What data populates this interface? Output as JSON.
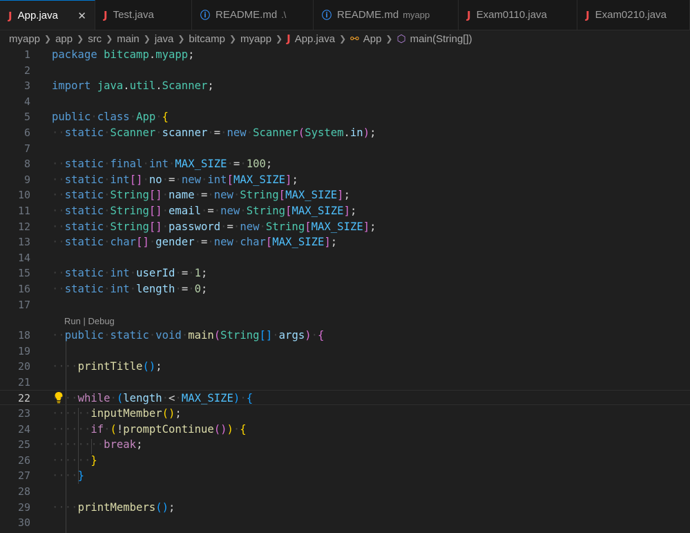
{
  "tabs": [
    {
      "label": "App.java",
      "icon": "java-icon",
      "active": true,
      "close": "✕"
    },
    {
      "label": "Test.java",
      "icon": "java-icon"
    },
    {
      "label": "README.md",
      "icon": "info-icon",
      "desc": ".\\"
    },
    {
      "label": "README.md",
      "icon": "info-icon",
      "desc": "myapp"
    },
    {
      "label": "Exam0110.java",
      "icon": "java-icon"
    },
    {
      "label": "Exam0210.java",
      "icon": "java-icon"
    }
  ],
  "breadcrumb": [
    "myapp",
    "app",
    "src",
    "main",
    "java",
    "bitcamp",
    "myapp",
    "App.java",
    "App",
    "main(String[])"
  ],
  "codelens": {
    "run": "Run",
    "separator": " | ",
    "debug": "Debug"
  },
  "current_line": 22,
  "colors": {
    "accent": "#0078d4",
    "java_icon": "#f14c4c",
    "info_icon": "#3794ff",
    "background": "#1f1f1f"
  },
  "lines": [
    {
      "n": "1",
      "tokens": [
        [
          "kw",
          "package"
        ],
        [
          "pn",
          " "
        ],
        [
          "ty",
          "bitcamp"
        ],
        [
          "pn",
          "."
        ],
        [
          "ty",
          "myapp"
        ],
        [
          "pn",
          ";"
        ]
      ]
    },
    {
      "n": "2",
      "tokens": []
    },
    {
      "n": "3",
      "tokens": [
        [
          "kw",
          "import"
        ],
        [
          "pn",
          " "
        ],
        [
          "ty",
          "java"
        ],
        [
          "pn",
          "."
        ],
        [
          "ty",
          "util"
        ],
        [
          "pn",
          "."
        ],
        [
          "ty",
          "Scanner"
        ],
        [
          "pn",
          ";"
        ]
      ]
    },
    {
      "n": "4",
      "tokens": []
    },
    {
      "n": "5",
      "tokens": [
        [
          "kw",
          "public"
        ],
        [
          "ws",
          "·"
        ],
        [
          "kw",
          "class"
        ],
        [
          "ws",
          "·"
        ],
        [
          "ty",
          "App"
        ],
        [
          "ws",
          "·"
        ],
        [
          "b1",
          "{"
        ]
      ]
    },
    {
      "n": "6",
      "tokens": [
        [
          "ws",
          "··"
        ],
        [
          "kw",
          "static"
        ],
        [
          "ws",
          "·"
        ],
        [
          "ty",
          "Scanner"
        ],
        [
          "ws",
          "·"
        ],
        [
          "va",
          "scanner"
        ],
        [
          "ws",
          "·"
        ],
        [
          "pn",
          "="
        ],
        [
          "ws",
          "·"
        ],
        [
          "kw",
          "new"
        ],
        [
          "ws",
          "·"
        ],
        [
          "ty",
          "Scanner"
        ],
        [
          "b2",
          "("
        ],
        [
          "ty",
          "System"
        ],
        [
          "pn",
          "."
        ],
        [
          "va",
          "in"
        ],
        [
          "b2",
          ")"
        ],
        [
          "pn",
          ";"
        ]
      ]
    },
    {
      "n": "7",
      "tokens": []
    },
    {
      "n": "8",
      "tokens": [
        [
          "ws",
          "··"
        ],
        [
          "kw",
          "static"
        ],
        [
          "ws",
          "·"
        ],
        [
          "kw",
          "final"
        ],
        [
          "ws",
          "·"
        ],
        [
          "kw",
          "int"
        ],
        [
          "ws",
          "·"
        ],
        [
          "co",
          "MAX_SIZE"
        ],
        [
          "ws",
          "·"
        ],
        [
          "pn",
          "="
        ],
        [
          "ws",
          "·"
        ],
        [
          "nu",
          "100"
        ],
        [
          "pn",
          ";"
        ]
      ]
    },
    {
      "n": "9",
      "tokens": [
        [
          "ws",
          "··"
        ],
        [
          "kw",
          "static"
        ],
        [
          "ws",
          "·"
        ],
        [
          "kw",
          "int"
        ],
        [
          "b2",
          "[]"
        ],
        [
          "ws",
          "·"
        ],
        [
          "va",
          "no"
        ],
        [
          "ws",
          "·"
        ],
        [
          "pn",
          "="
        ],
        [
          "ws",
          "·"
        ],
        [
          "kw",
          "new"
        ],
        [
          "ws",
          "·"
        ],
        [
          "kw",
          "int"
        ],
        [
          "b2",
          "["
        ],
        [
          "co",
          "MAX_SIZE"
        ],
        [
          "b2",
          "]"
        ],
        [
          "pn",
          ";"
        ]
      ]
    },
    {
      "n": "10",
      "tokens": [
        [
          "ws",
          "··"
        ],
        [
          "kw",
          "static"
        ],
        [
          "ws",
          "·"
        ],
        [
          "ty",
          "String"
        ],
        [
          "b2",
          "[]"
        ],
        [
          "ws",
          "·"
        ],
        [
          "va",
          "name"
        ],
        [
          "ws",
          "·"
        ],
        [
          "pn",
          "="
        ],
        [
          "ws",
          "·"
        ],
        [
          "kw",
          "new"
        ],
        [
          "ws",
          "·"
        ],
        [
          "ty",
          "String"
        ],
        [
          "b2",
          "["
        ],
        [
          "co",
          "MAX_SIZE"
        ],
        [
          "b2",
          "]"
        ],
        [
          "pn",
          ";"
        ]
      ]
    },
    {
      "n": "11",
      "tokens": [
        [
          "ws",
          "··"
        ],
        [
          "kw",
          "static"
        ],
        [
          "ws",
          "·"
        ],
        [
          "ty",
          "String"
        ],
        [
          "b2",
          "[]"
        ],
        [
          "ws",
          "·"
        ],
        [
          "va",
          "email"
        ],
        [
          "ws",
          "·"
        ],
        [
          "pn",
          "="
        ],
        [
          "ws",
          "·"
        ],
        [
          "kw",
          "new"
        ],
        [
          "ws",
          "·"
        ],
        [
          "ty",
          "String"
        ],
        [
          "b2",
          "["
        ],
        [
          "co",
          "MAX_SIZE"
        ],
        [
          "b2",
          "]"
        ],
        [
          "pn",
          ";"
        ]
      ]
    },
    {
      "n": "12",
      "tokens": [
        [
          "ws",
          "··"
        ],
        [
          "kw",
          "static"
        ],
        [
          "ws",
          "·"
        ],
        [
          "ty",
          "String"
        ],
        [
          "b2",
          "[]"
        ],
        [
          "ws",
          "·"
        ],
        [
          "va",
          "password"
        ],
        [
          "ws",
          "·"
        ],
        [
          "pn",
          "="
        ],
        [
          "ws",
          "·"
        ],
        [
          "kw",
          "new"
        ],
        [
          "ws",
          "·"
        ],
        [
          "ty",
          "String"
        ],
        [
          "b2",
          "["
        ],
        [
          "co",
          "MAX_SIZE"
        ],
        [
          "b2",
          "]"
        ],
        [
          "pn",
          ";"
        ]
      ]
    },
    {
      "n": "13",
      "tokens": [
        [
          "ws",
          "··"
        ],
        [
          "kw",
          "static"
        ],
        [
          "ws",
          "·"
        ],
        [
          "kw",
          "char"
        ],
        [
          "b2",
          "[]"
        ],
        [
          "ws",
          "·"
        ],
        [
          "va",
          "gender"
        ],
        [
          "ws",
          "·"
        ],
        [
          "pn",
          "="
        ],
        [
          "ws",
          "·"
        ],
        [
          "kw",
          "new"
        ],
        [
          "ws",
          "·"
        ],
        [
          "kw",
          "char"
        ],
        [
          "b2",
          "["
        ],
        [
          "co",
          "MAX_SIZE"
        ],
        [
          "b2",
          "]"
        ],
        [
          "pn",
          ";"
        ]
      ]
    },
    {
      "n": "14",
      "tokens": []
    },
    {
      "n": "15",
      "tokens": [
        [
          "ws",
          "··"
        ],
        [
          "kw",
          "static"
        ],
        [
          "ws",
          "·"
        ],
        [
          "kw",
          "int"
        ],
        [
          "ws",
          "·"
        ],
        [
          "va",
          "userId"
        ],
        [
          "ws",
          "·"
        ],
        [
          "pn",
          "="
        ],
        [
          "ws",
          "·"
        ],
        [
          "nu",
          "1"
        ],
        [
          "pn",
          ";"
        ]
      ]
    },
    {
      "n": "16",
      "tokens": [
        [
          "ws",
          "··"
        ],
        [
          "kw",
          "static"
        ],
        [
          "ws",
          "·"
        ],
        [
          "kw",
          "int"
        ],
        [
          "ws",
          "·"
        ],
        [
          "va",
          "length"
        ],
        [
          "ws",
          "·"
        ],
        [
          "pn",
          "="
        ],
        [
          "ws",
          "·"
        ],
        [
          "nu",
          "0"
        ],
        [
          "pn",
          ";"
        ]
      ]
    },
    {
      "n": "17",
      "tokens": []
    },
    {
      "n": "18",
      "tokens": [
        [
          "ws",
          "··"
        ],
        [
          "kw",
          "public"
        ],
        [
          "ws",
          "·"
        ],
        [
          "kw",
          "static"
        ],
        [
          "ws",
          "·"
        ],
        [
          "kw",
          "void"
        ],
        [
          "ws",
          "·"
        ],
        [
          "fn",
          "main"
        ],
        [
          "b2",
          "("
        ],
        [
          "ty",
          "String"
        ],
        [
          "b3",
          "[]"
        ],
        [
          "ws",
          "·"
        ],
        [
          "va",
          "args"
        ],
        [
          "b2",
          ")"
        ],
        [
          "ws",
          "·"
        ],
        [
          "b2",
          "{"
        ]
      ]
    },
    {
      "n": "19",
      "tokens": []
    },
    {
      "n": "20",
      "tokens": [
        [
          "ws",
          "····"
        ],
        [
          "fn",
          "printTitle"
        ],
        [
          "b3",
          "()"
        ],
        [
          "pn",
          ";"
        ]
      ]
    },
    {
      "n": "21",
      "tokens": []
    },
    {
      "n": "22",
      "tokens": [
        [
          "ws",
          "····"
        ],
        [
          "kc",
          "while"
        ],
        [
          "ws",
          "·"
        ],
        [
          "b3",
          "("
        ],
        [
          "va",
          "length"
        ],
        [
          "ws",
          "·"
        ],
        [
          "pn",
          "<"
        ],
        [
          "ws",
          "·"
        ],
        [
          "co",
          "MAX_SIZE"
        ],
        [
          "b3",
          ")"
        ],
        [
          "ws",
          "·"
        ],
        [
          "b3",
          "{"
        ]
      ]
    },
    {
      "n": "23",
      "tokens": [
        [
          "ws",
          "······"
        ],
        [
          "fn",
          "inputMember"
        ],
        [
          "b1",
          "()"
        ],
        [
          "pn",
          ";"
        ]
      ]
    },
    {
      "n": "24",
      "tokens": [
        [
          "ws",
          "······"
        ],
        [
          "kc",
          "if"
        ],
        [
          "ws",
          "·"
        ],
        [
          "b1",
          "("
        ],
        [
          "pn",
          "!"
        ],
        [
          "fn",
          "promptContinue"
        ],
        [
          "b2",
          "()"
        ],
        [
          "b1",
          ")"
        ],
        [
          "ws",
          "·"
        ],
        [
          "b1",
          "{"
        ]
      ]
    },
    {
      "n": "25",
      "tokens": [
        [
          "ws",
          "········"
        ],
        [
          "kc",
          "break"
        ],
        [
          "pn",
          ";"
        ]
      ]
    },
    {
      "n": "26",
      "tokens": [
        [
          "ws",
          "······"
        ],
        [
          "b1",
          "}"
        ]
      ]
    },
    {
      "n": "27",
      "tokens": [
        [
          "ws",
          "····"
        ],
        [
          "b3",
          "}"
        ]
      ]
    },
    {
      "n": "28",
      "tokens": []
    },
    {
      "n": "29",
      "tokens": [
        [
          "ws",
          "····"
        ],
        [
          "fn",
          "printMembers"
        ],
        [
          "b3",
          "()"
        ],
        [
          "pn",
          ";"
        ]
      ]
    },
    {
      "n": "30",
      "tokens": []
    }
  ]
}
